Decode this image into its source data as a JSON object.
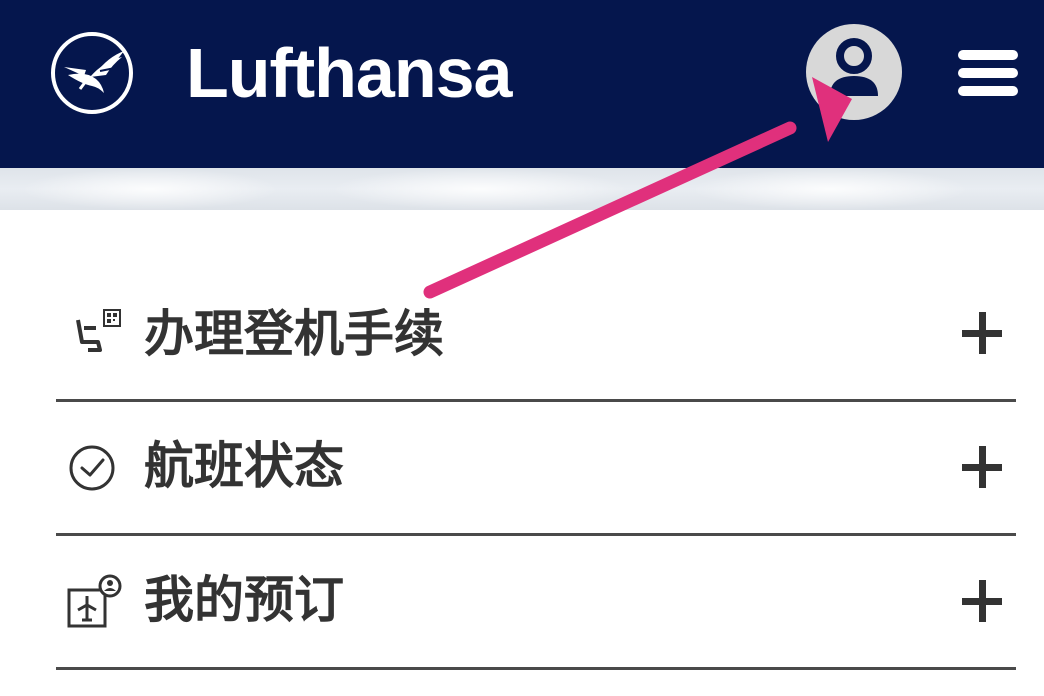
{
  "header": {
    "brand": "Lufthansa",
    "background_color": "#05164d",
    "logo_icon": "crane-logo-icon",
    "account_icon": "user-account-icon",
    "menu_icon": "hamburger-menu-icon"
  },
  "accordion": {
    "items": [
      {
        "label": "办理登机手续",
        "icon": "seat-boarding-pass-icon",
        "expand_icon": "plus-icon"
      },
      {
        "label": "航班状态",
        "icon": "clock-check-icon",
        "expand_icon": "plus-icon"
      },
      {
        "label": "我的预订",
        "icon": "my-booking-icon",
        "expand_icon": "plus-icon"
      }
    ]
  },
  "annotation": {
    "arrow_color": "#e0307c"
  }
}
